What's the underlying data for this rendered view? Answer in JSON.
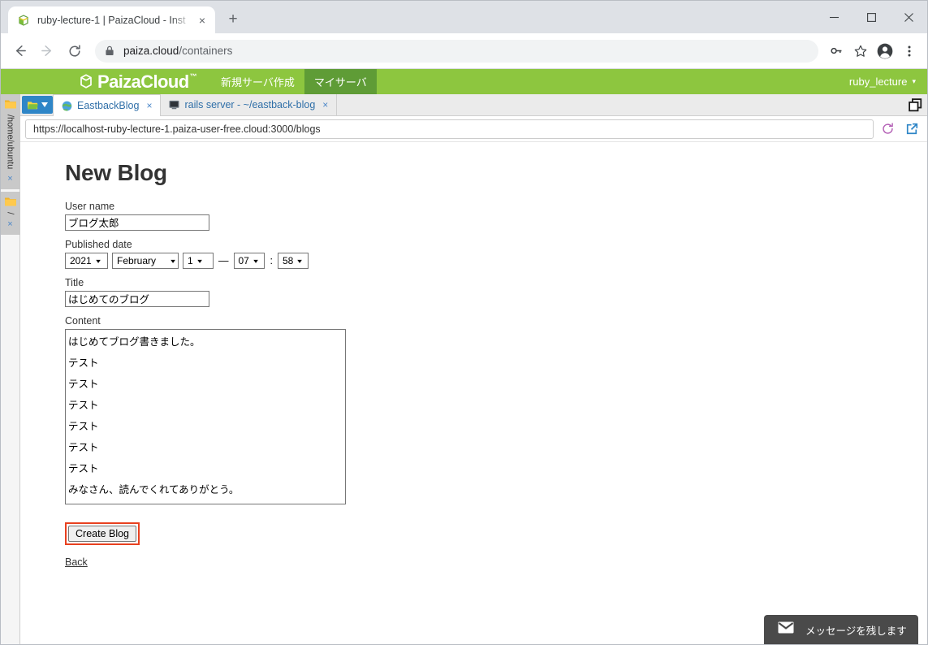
{
  "browser": {
    "tab": {
      "title": "ruby-lecture-1 | PaizaCloud - Inst",
      "favicon": "paizacloud-cube-icon",
      "close": "×"
    },
    "new_tab": "+",
    "window_controls": {
      "minimize": "—",
      "maximize": "□",
      "close": "✕"
    },
    "nav": {
      "back": "←",
      "forward": "→",
      "reload": "⟳"
    },
    "omnibox": {
      "lock": "lock-icon",
      "url_host": "paiza.cloud",
      "url_path": "/containers"
    },
    "toolbar_icons": [
      "key-icon",
      "star-icon",
      "profile-icon",
      "menu-dots-icon"
    ]
  },
  "paizacloud": {
    "logo": "PaizaCloud",
    "logo_tm": "™",
    "nav": [
      {
        "label": "新規サーバ作成",
        "active": false
      },
      {
        "label": "マイサーバ",
        "active": true
      }
    ],
    "user": "ruby_lecture",
    "user_caret": "▾"
  },
  "sidebar": {
    "groups": [
      {
        "folder": "folder-icon",
        "label": "/home/ubuntu",
        "close": "×"
      },
      {
        "folder": "folder-icon",
        "label": "/",
        "close": "×"
      }
    ]
  },
  "workspace": {
    "tab_menu": {
      "icon": "folder-open-icon",
      "caret": "▼"
    },
    "tabs": [
      {
        "label": "EastbackBlog",
        "icon": "globe-icon",
        "close": "×",
        "active": true
      },
      {
        "label": "rails server - ~/eastback-blog",
        "icon": "terminal-icon",
        "close": "×",
        "active": false
      }
    ],
    "window_icon": "restore-windows-icon",
    "url": "https://localhost-ruby-lecture-1.paiza-user-free.cloud:3000/blogs",
    "reload_icon": "reload-icon",
    "popout_icon": "open-external-icon"
  },
  "form": {
    "heading": "New Blog",
    "user_name": {
      "label": "User name",
      "value": "ブログ太郎"
    },
    "published_date": {
      "label": "Published date",
      "year": "2021",
      "month": "February",
      "day": "1",
      "separator": "—",
      "hour": "07",
      "time_separator": ":",
      "minute": "58",
      "caret": "▾"
    },
    "title": {
      "label": "Title",
      "value": "はじめてのブログ"
    },
    "content": {
      "label": "Content",
      "value": "はじめてブログ書きました。\nテスト\nテスト\nテスト\nテスト\nテスト\nテスト\nみなさん、読んでくれてありがとう。"
    },
    "submit": "Create Blog",
    "back": "Back"
  },
  "chat_widget": {
    "icon": "envelope-icon",
    "label": "メッセージを残します"
  },
  "colors": {
    "brand_green": "#8dc63f",
    "brand_green_active": "#5f9c36",
    "highlight_red": "#e8401f",
    "link_blue": "#2f6fa8",
    "chat_gray": "#4a4a4a"
  }
}
